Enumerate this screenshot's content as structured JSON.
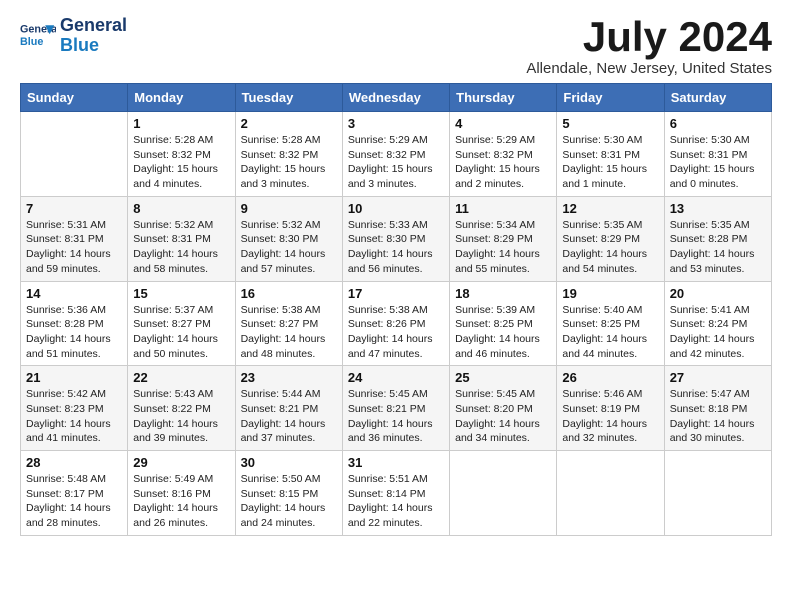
{
  "header": {
    "logo_line1": "General",
    "logo_line2": "Blue",
    "month_year": "July 2024",
    "location": "Allendale, New Jersey, United States"
  },
  "days_of_week": [
    "Sunday",
    "Monday",
    "Tuesday",
    "Wednesday",
    "Thursday",
    "Friday",
    "Saturday"
  ],
  "weeks": [
    [
      {
        "day": "",
        "info": ""
      },
      {
        "day": "1",
        "info": "Sunrise: 5:28 AM\nSunset: 8:32 PM\nDaylight: 15 hours\nand 4 minutes."
      },
      {
        "day": "2",
        "info": "Sunrise: 5:28 AM\nSunset: 8:32 PM\nDaylight: 15 hours\nand 3 minutes."
      },
      {
        "day": "3",
        "info": "Sunrise: 5:29 AM\nSunset: 8:32 PM\nDaylight: 15 hours\nand 3 minutes."
      },
      {
        "day": "4",
        "info": "Sunrise: 5:29 AM\nSunset: 8:32 PM\nDaylight: 15 hours\nand 2 minutes."
      },
      {
        "day": "5",
        "info": "Sunrise: 5:30 AM\nSunset: 8:31 PM\nDaylight: 15 hours\nand 1 minute."
      },
      {
        "day": "6",
        "info": "Sunrise: 5:30 AM\nSunset: 8:31 PM\nDaylight: 15 hours\nand 0 minutes."
      }
    ],
    [
      {
        "day": "7",
        "info": "Sunrise: 5:31 AM\nSunset: 8:31 PM\nDaylight: 14 hours\nand 59 minutes."
      },
      {
        "day": "8",
        "info": "Sunrise: 5:32 AM\nSunset: 8:31 PM\nDaylight: 14 hours\nand 58 minutes."
      },
      {
        "day": "9",
        "info": "Sunrise: 5:32 AM\nSunset: 8:30 PM\nDaylight: 14 hours\nand 57 minutes."
      },
      {
        "day": "10",
        "info": "Sunrise: 5:33 AM\nSunset: 8:30 PM\nDaylight: 14 hours\nand 56 minutes."
      },
      {
        "day": "11",
        "info": "Sunrise: 5:34 AM\nSunset: 8:29 PM\nDaylight: 14 hours\nand 55 minutes."
      },
      {
        "day": "12",
        "info": "Sunrise: 5:35 AM\nSunset: 8:29 PM\nDaylight: 14 hours\nand 54 minutes."
      },
      {
        "day": "13",
        "info": "Sunrise: 5:35 AM\nSunset: 8:28 PM\nDaylight: 14 hours\nand 53 minutes."
      }
    ],
    [
      {
        "day": "14",
        "info": "Sunrise: 5:36 AM\nSunset: 8:28 PM\nDaylight: 14 hours\nand 51 minutes."
      },
      {
        "day": "15",
        "info": "Sunrise: 5:37 AM\nSunset: 8:27 PM\nDaylight: 14 hours\nand 50 minutes."
      },
      {
        "day": "16",
        "info": "Sunrise: 5:38 AM\nSunset: 8:27 PM\nDaylight: 14 hours\nand 48 minutes."
      },
      {
        "day": "17",
        "info": "Sunrise: 5:38 AM\nSunset: 8:26 PM\nDaylight: 14 hours\nand 47 minutes."
      },
      {
        "day": "18",
        "info": "Sunrise: 5:39 AM\nSunset: 8:25 PM\nDaylight: 14 hours\nand 46 minutes."
      },
      {
        "day": "19",
        "info": "Sunrise: 5:40 AM\nSunset: 8:25 PM\nDaylight: 14 hours\nand 44 minutes."
      },
      {
        "day": "20",
        "info": "Sunrise: 5:41 AM\nSunset: 8:24 PM\nDaylight: 14 hours\nand 42 minutes."
      }
    ],
    [
      {
        "day": "21",
        "info": "Sunrise: 5:42 AM\nSunset: 8:23 PM\nDaylight: 14 hours\nand 41 minutes."
      },
      {
        "day": "22",
        "info": "Sunrise: 5:43 AM\nSunset: 8:22 PM\nDaylight: 14 hours\nand 39 minutes."
      },
      {
        "day": "23",
        "info": "Sunrise: 5:44 AM\nSunset: 8:21 PM\nDaylight: 14 hours\nand 37 minutes."
      },
      {
        "day": "24",
        "info": "Sunrise: 5:45 AM\nSunset: 8:21 PM\nDaylight: 14 hours\nand 36 minutes."
      },
      {
        "day": "25",
        "info": "Sunrise: 5:45 AM\nSunset: 8:20 PM\nDaylight: 14 hours\nand 34 minutes."
      },
      {
        "day": "26",
        "info": "Sunrise: 5:46 AM\nSunset: 8:19 PM\nDaylight: 14 hours\nand 32 minutes."
      },
      {
        "day": "27",
        "info": "Sunrise: 5:47 AM\nSunset: 8:18 PM\nDaylight: 14 hours\nand 30 minutes."
      }
    ],
    [
      {
        "day": "28",
        "info": "Sunrise: 5:48 AM\nSunset: 8:17 PM\nDaylight: 14 hours\nand 28 minutes."
      },
      {
        "day": "29",
        "info": "Sunrise: 5:49 AM\nSunset: 8:16 PM\nDaylight: 14 hours\nand 26 minutes."
      },
      {
        "day": "30",
        "info": "Sunrise: 5:50 AM\nSunset: 8:15 PM\nDaylight: 14 hours\nand 24 minutes."
      },
      {
        "day": "31",
        "info": "Sunrise: 5:51 AM\nSunset: 8:14 PM\nDaylight: 14 hours\nand 22 minutes."
      },
      {
        "day": "",
        "info": ""
      },
      {
        "day": "",
        "info": ""
      },
      {
        "day": "",
        "info": ""
      }
    ]
  ]
}
